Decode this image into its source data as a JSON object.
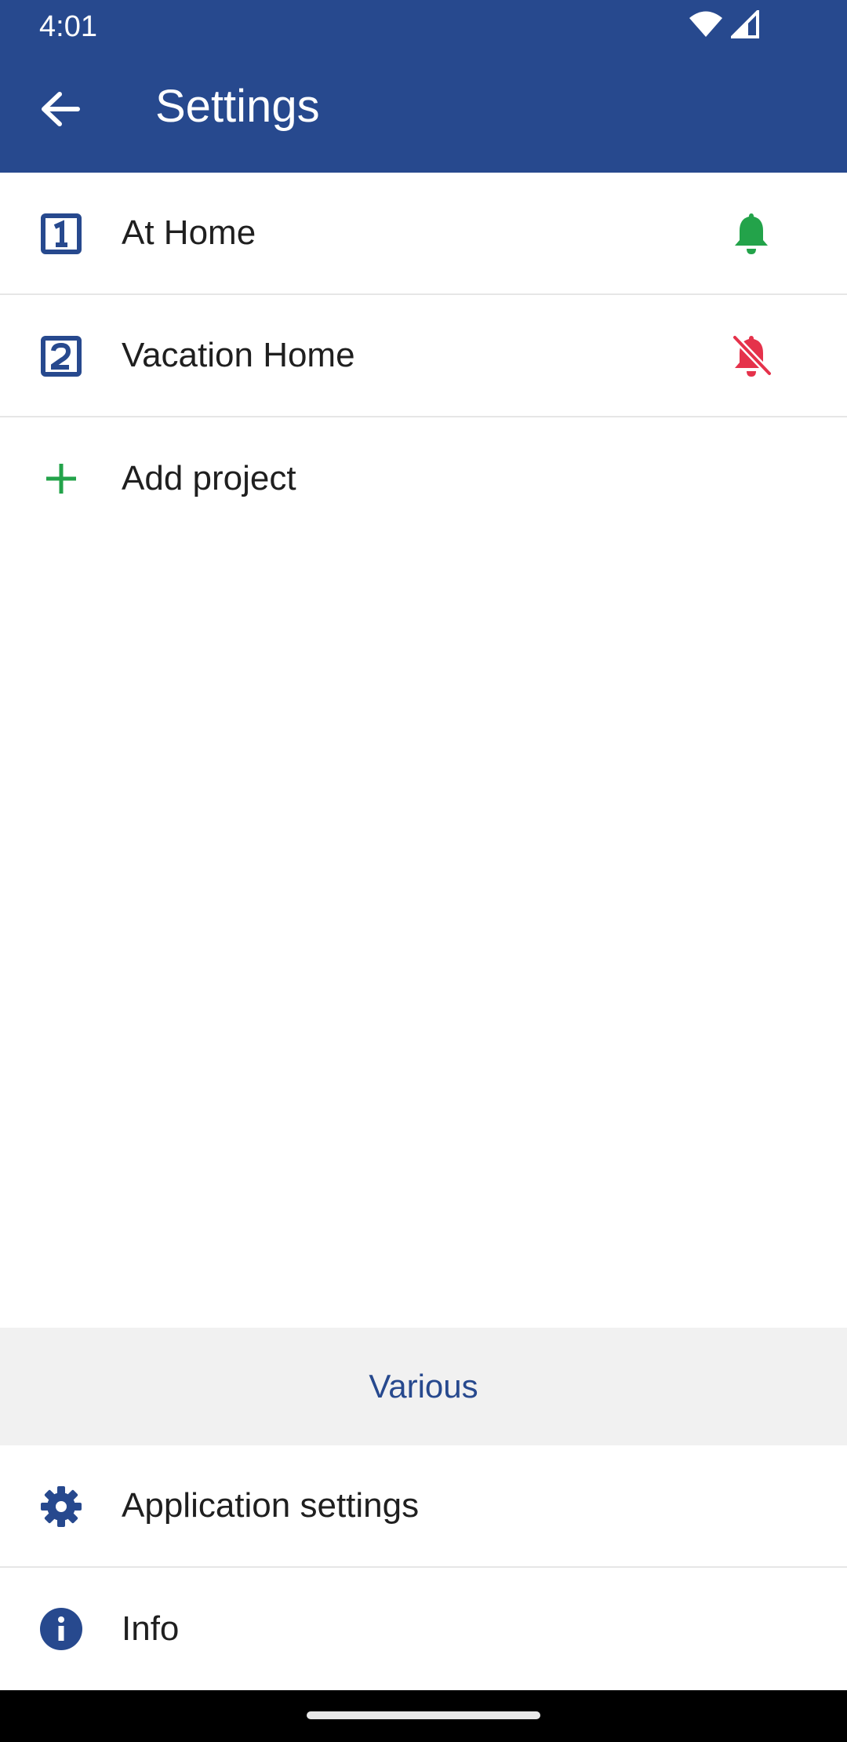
{
  "status_bar": {
    "time": "4:01",
    "icons": [
      "wifi-icon",
      "signal-icon"
    ]
  },
  "header": {
    "title": "Settings",
    "back_icon": "arrow-back-icon",
    "background_color": "#27498e"
  },
  "projects": [
    {
      "label": "At Home",
      "number_icon": "number-one-box-icon",
      "notification_icon": "bell-active-icon",
      "notification_color": "#23a34a"
    },
    {
      "label": "Vacation Home",
      "number_icon": "number-two-box-icon",
      "notification_icon": "bell-off-icon",
      "notification_color": "#e5324b"
    }
  ],
  "add_project": {
    "label": "Add project",
    "icon": "plus-icon",
    "icon_color": "#23a34a"
  },
  "various": {
    "header": "Various",
    "items": [
      {
        "label": "Application settings",
        "icon": "gear-icon"
      },
      {
        "label": "Info",
        "icon": "info-icon"
      }
    ]
  },
  "colors": {
    "brand": "#27498e",
    "active": "#23a34a",
    "inactive": "#e5324b"
  }
}
